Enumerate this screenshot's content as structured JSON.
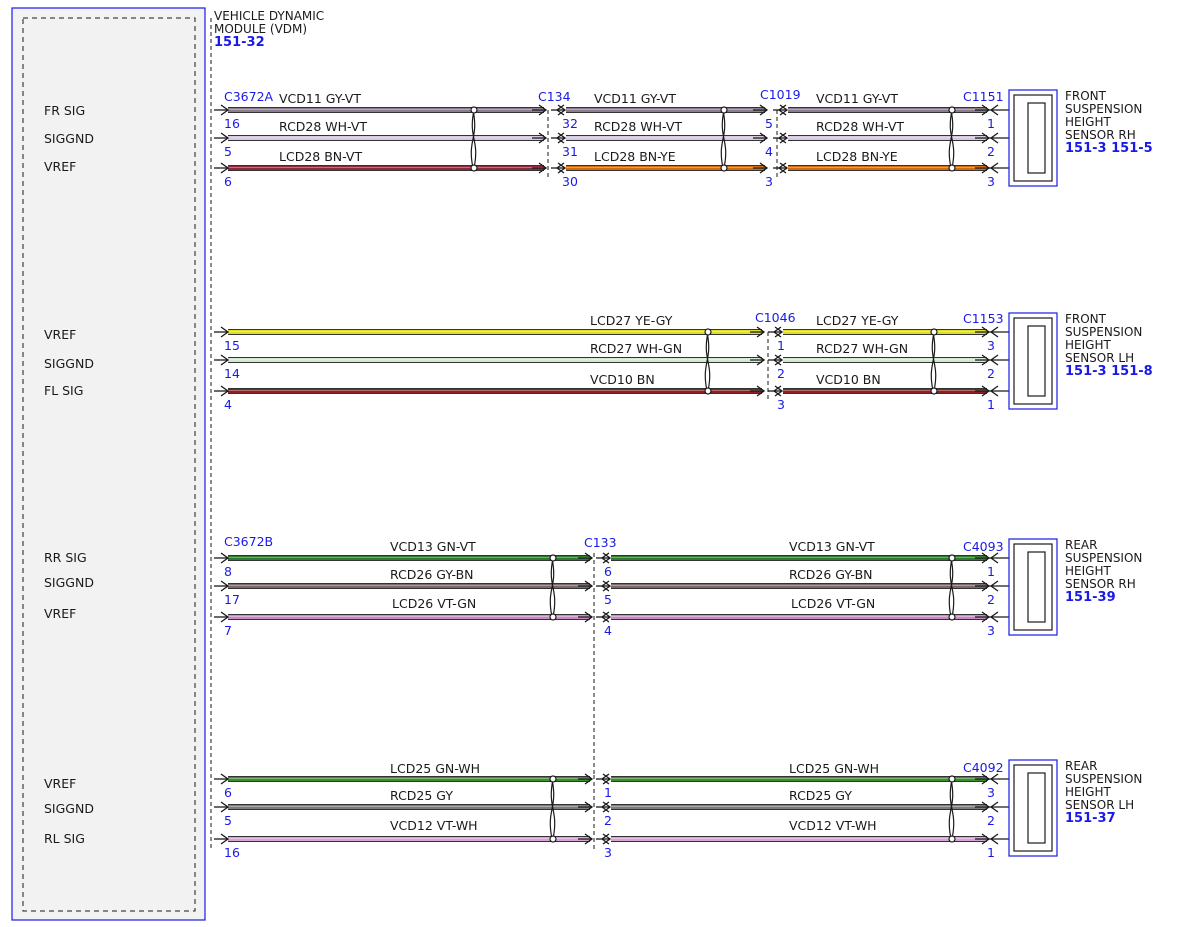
{
  "module": {
    "name_line1": "VEHICLE DYNAMIC",
    "name_line2": "MODULE (VDM)",
    "ref": "151-32",
    "pins": [
      "FR SIG",
      "SIGGND",
      "VREF",
      "VREF",
      "SIGGND",
      "FL SIG",
      "RR SIG",
      "SIGGND",
      "VREF",
      "VREF",
      "SIGGND",
      "RL SIG"
    ]
  },
  "colors": {
    "GY-VT": "#8a7d8e",
    "WH-VT": "#d6c8df",
    "BN-VT": "#8e2a3e",
    "BN-YE": "#d36c10",
    "YE-GY": "#dede2c",
    "WH-GN": "#d2e8d2",
    "BN": "#8a2020",
    "GN-VT": "#2e7a2e",
    "GY-BN": "#7a6a6a",
    "VT-GN": "#c88ac8",
    "GN-WH": "#3a8f2a",
    "GY": "#7d7d7d",
    "VT-WH": "#d9a2d9",
    "line": "#1a1a1a",
    "blue": "#1a1ae6",
    "module_fill": "#f2f2f2"
  },
  "groups": [
    {
      "id": "fr",
      "connectors": [
        "C3672A",
        "C134",
        "C1019",
        "C1151"
      ],
      "segments": [
        {
          "pins_start": [
            "16",
            "5",
            "6"
          ],
          "pins_end": [
            "32",
            "31",
            "30"
          ],
          "wires": [
            {
              "circuit": "VCD11",
              "color": "GY-VT"
            },
            {
              "circuit": "RCD28",
              "color": "WH-VT"
            },
            {
              "circuit": "LCD28",
              "color": "BN-VT"
            }
          ]
        },
        {
          "pins_end": [
            "5",
            "4",
            "3"
          ],
          "wires": [
            {
              "circuit": "VCD11",
              "color": "GY-VT"
            },
            {
              "circuit": "RCD28",
              "color": "WH-VT"
            },
            {
              "circuit": "LCD28",
              "color": "BN-YE"
            }
          ]
        },
        {
          "pins_end": [
            "1",
            "2",
            "3"
          ],
          "wires": [
            {
              "circuit": "VCD11",
              "color": "GY-VT"
            },
            {
              "circuit": "RCD28",
              "color": "WH-VT"
            },
            {
              "circuit": "LCD28",
              "color": "BN-YE"
            }
          ]
        }
      ],
      "component": {
        "lines": [
          "FRONT",
          "SUSPENSION",
          "HEIGHT",
          "SENSOR RH"
        ],
        "ref": "151-3 151-5"
      }
    },
    {
      "id": "fl",
      "connectors": [
        "",
        "C1046",
        "C1153"
      ],
      "segments": [
        {
          "pins_start": [
            "15",
            "14",
            "4"
          ],
          "pins_end": [
            "1",
            "2",
            "3"
          ],
          "wires": [
            {
              "circuit": "LCD27",
              "color": "YE-GY"
            },
            {
              "circuit": "RCD27",
              "color": "WH-GN"
            },
            {
              "circuit": "VCD10",
              "color": "BN"
            }
          ]
        },
        {
          "pins_end": [
            "3",
            "2",
            "1"
          ],
          "wires": [
            {
              "circuit": "LCD27",
              "color": "YE-GY"
            },
            {
              "circuit": "RCD27",
              "color": "WH-GN"
            },
            {
              "circuit": "VCD10",
              "color": "BN"
            }
          ]
        }
      ],
      "component": {
        "lines": [
          "FRONT",
          "SUSPENSION",
          "HEIGHT",
          "SENSOR LH"
        ],
        "ref": "151-3 151-8"
      }
    },
    {
      "id": "rr",
      "connectors": [
        "C3672B",
        "C133",
        "C4093"
      ],
      "segments": [
        {
          "pins_start": [
            "8",
            "17",
            "7"
          ],
          "pins_end": [
            "6",
            "5",
            "4"
          ],
          "wires": [
            {
              "circuit": "VCD13",
              "color": "GN-VT"
            },
            {
              "circuit": "RCD26",
              "color": "GY-BN"
            },
            {
              "circuit": "LCD26",
              "color": "VT-GN"
            }
          ]
        },
        {
          "pins_end": [
            "1",
            "2",
            "3"
          ],
          "wires": [
            {
              "circuit": "VCD13",
              "color": "GN-VT"
            },
            {
              "circuit": "RCD26",
              "color": "GY-BN"
            },
            {
              "circuit": "LCD26",
              "color": "VT-GN"
            }
          ]
        }
      ],
      "component": {
        "lines": [
          "REAR",
          "SUSPENSION",
          "HEIGHT",
          "SENSOR RH"
        ],
        "ref": "151-39"
      }
    },
    {
      "id": "rl",
      "connectors": [
        "",
        "",
        "C4092"
      ],
      "segments": [
        {
          "pins_start": [
            "6",
            "5",
            "16"
          ],
          "pins_end": [
            "1",
            "2",
            "3"
          ],
          "wires": [
            {
              "circuit": "LCD25",
              "color": "GN-WH"
            },
            {
              "circuit": "RCD25",
              "color": "GY"
            },
            {
              "circuit": "VCD12",
              "color": "VT-WH"
            }
          ]
        },
        {
          "pins_end": [
            "3",
            "2",
            "1"
          ],
          "wires": [
            {
              "circuit": "LCD25",
              "color": "GN-WH"
            },
            {
              "circuit": "RCD25",
              "color": "GY"
            },
            {
              "circuit": "VCD12",
              "color": "VT-WH"
            }
          ]
        }
      ],
      "component": {
        "lines": [
          "REAR",
          "SUSPENSION",
          "HEIGHT",
          "SENSOR LH"
        ],
        "ref": "151-37"
      }
    }
  ]
}
